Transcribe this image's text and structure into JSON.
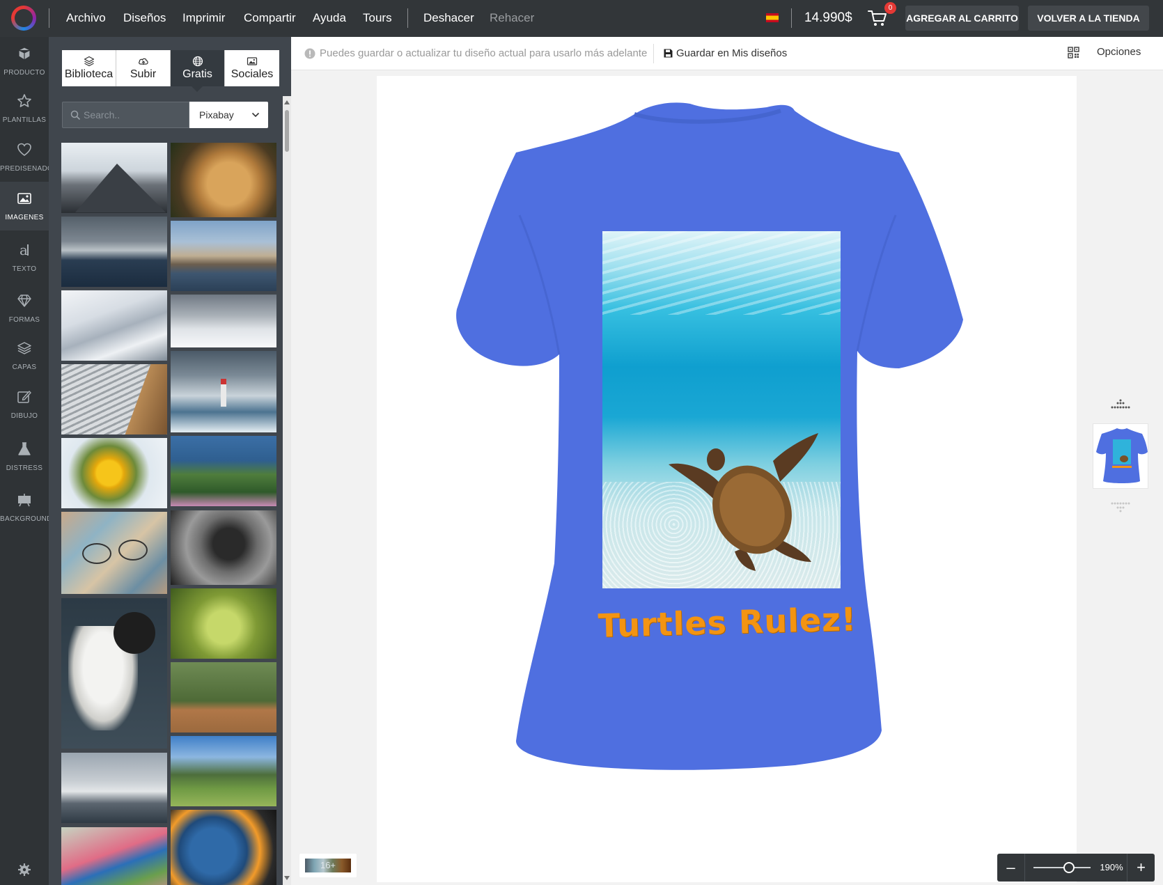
{
  "menu": {
    "items": [
      {
        "label": "Archivo"
      },
      {
        "label": "Diseños"
      },
      {
        "label": "Imprimir"
      },
      {
        "label": "Compartir"
      },
      {
        "label": "Ayuda"
      },
      {
        "label": "Tours"
      }
    ],
    "undo": "Deshacer",
    "redo": "Rehacer"
  },
  "header": {
    "price": "14.990$",
    "cart_count": "0",
    "add_to_cart": "AGREGAR AL CARRITO",
    "back_to_store": "VOLVER A LA TIENDA",
    "language_flag": "spain-flag-icon"
  },
  "sidebar": {
    "items": [
      {
        "label": "PRODUCTO",
        "icon": "cube-icon"
      },
      {
        "label": "PLANTILLAS",
        "icon": "star-icon"
      },
      {
        "label": "PREDISEÑADO",
        "icon": "heart-icon"
      },
      {
        "label": "IMÁGENES",
        "icon": "image-icon",
        "active": true
      },
      {
        "label": "TEXTO",
        "icon": "text-icon"
      },
      {
        "label": "FORMAS",
        "icon": "diamond-icon"
      },
      {
        "label": "CAPAS",
        "icon": "layers-icon"
      },
      {
        "label": "DIBUJO",
        "icon": "pencil-icon"
      },
      {
        "label": "DISTRESS",
        "icon": "flask-icon"
      },
      {
        "label": "BACKGROUND",
        "icon": "easel-icon"
      }
    ]
  },
  "panel": {
    "tabs": [
      {
        "label": "Biblioteca",
        "icon": "layers-icon"
      },
      {
        "label": "Subir",
        "icon": "cloud-upload-icon"
      },
      {
        "label": "Gratis",
        "icon": "globe-icon",
        "active": true
      },
      {
        "label": "Sociales",
        "icon": "image-icon"
      }
    ],
    "search_placeholder": "Search..",
    "source": "Pixabay",
    "thumbnails": [
      "snowy-mountain-peak",
      "cheetah",
      "stormy-sea",
      "lakeside-town",
      "snowy-slope",
      "cloudy-snowfield",
      "curved-roof",
      "lighthouse-glacier",
      "sunflower",
      "lake-trees-flowers",
      "glasses-on-map",
      "gibbon",
      "tamarin-monkey",
      "green-bud",
      "bird-on-fence",
      "marina",
      "alpine-village",
      "lovebird-on-flower",
      "macaw"
    ]
  },
  "toolbar": {
    "notice": "Puedes guardar o actualizar tu diseño actual para usarlo más adelante",
    "save_label": "Guardar en Mis diseños",
    "options_label": "Opciones"
  },
  "design": {
    "shirt_color": "#4f6fe0",
    "print_text": "Turtles Rulez!",
    "print_text_color": "#f39412",
    "print_image": "sea-turtle-underwater"
  },
  "canvas_controls": {
    "palette_count": "16+",
    "zoom": "190%",
    "zoom_level": 0.62
  }
}
